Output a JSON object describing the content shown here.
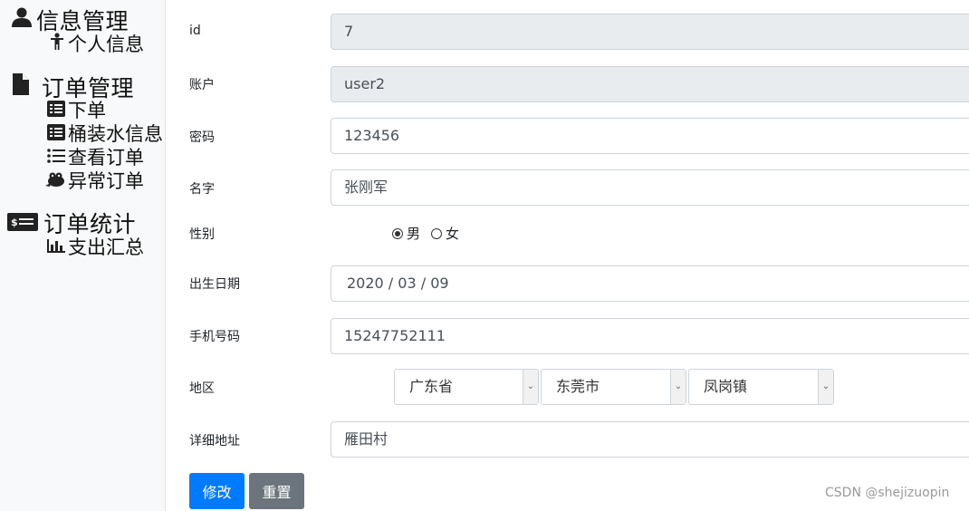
{
  "sidebar": {
    "groups": [
      {
        "title": "信息管理",
        "icon": "user-icon",
        "items": [
          {
            "label": "个人信息",
            "icon": "person-icon"
          }
        ]
      },
      {
        "title": "订单管理",
        "icon": "file-icon",
        "items": [
          {
            "label": "下单",
            "icon": "list-box-icon"
          },
          {
            "label": "桶装水信息",
            "icon": "list-box-icon"
          },
          {
            "label": "查看订单",
            "icon": "list-icon"
          },
          {
            "label": "异常订单",
            "icon": "frog-icon"
          }
        ]
      },
      {
        "title": "订单统计",
        "icon": "money-icon",
        "items": [
          {
            "label": "支出汇总",
            "icon": "bar-chart-icon"
          }
        ]
      }
    ]
  },
  "form": {
    "id": {
      "label": "id",
      "value": "7"
    },
    "account": {
      "label": "账户",
      "value": "user2"
    },
    "password": {
      "label": "密码",
      "value": "123456"
    },
    "name": {
      "label": "名字",
      "value": "张刚军"
    },
    "gender": {
      "label": "性别",
      "options": [
        "男",
        "女"
      ],
      "selected": "男"
    },
    "birthdate": {
      "label": "出生日期",
      "value": "2020 / 03 / 09"
    },
    "phone": {
      "label": "手机号码",
      "value": "15247752111"
    },
    "region": {
      "label": "地区",
      "province": "广东省",
      "city": "东莞市",
      "town": "凤岗镇"
    },
    "address": {
      "label": "详细地址",
      "value": "雁田村"
    }
  },
  "buttons": {
    "submit": "修改",
    "reset": "重置"
  },
  "watermark": "CSDN @shejizuopin",
  "colors": {
    "primary": "#007bff",
    "secondary": "#6c757d",
    "readonly_bg": "#e9ecef",
    "sidebar_bg": "#f8f9fa"
  }
}
